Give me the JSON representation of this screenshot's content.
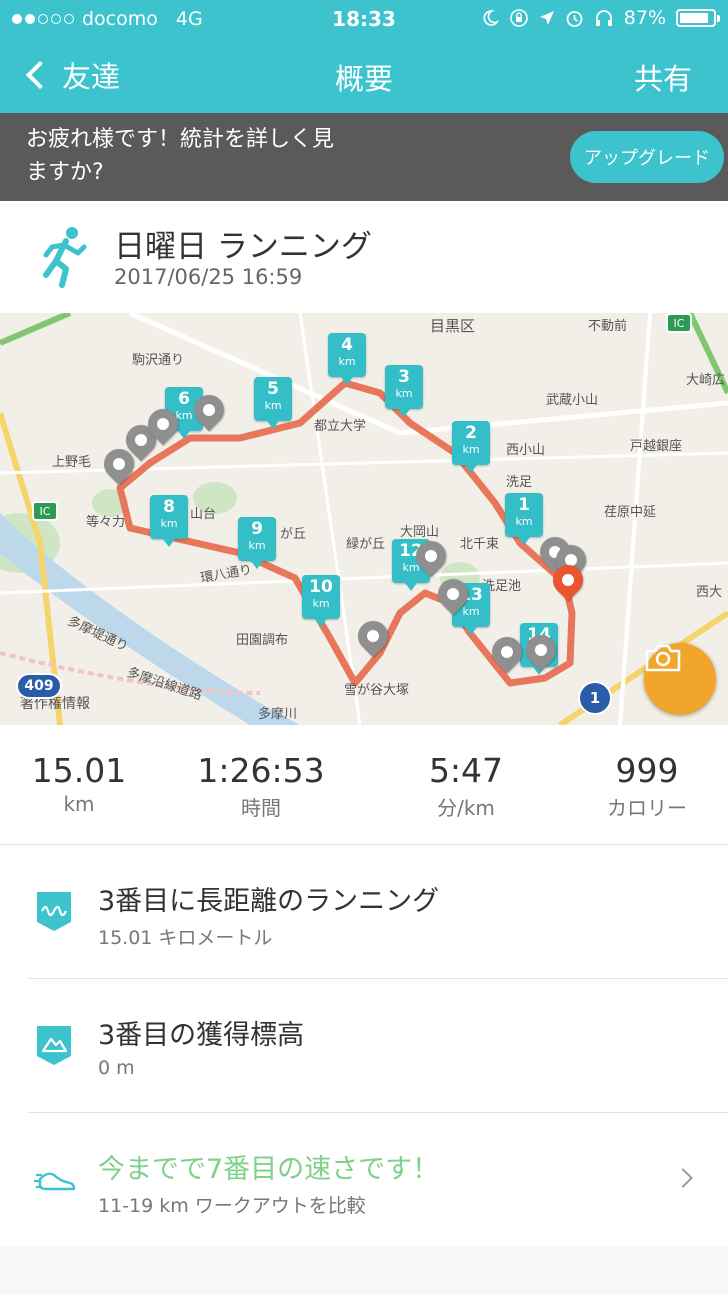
{
  "status_bar": {
    "carrier": "docomo",
    "network": "4G",
    "time": "18:33",
    "battery": "87%",
    "battery_level": 0.87,
    "signal_bars_filled": 2,
    "signal_bars_total": 5
  },
  "nav": {
    "back_label": "友達",
    "title": "概要",
    "share_label": "共有"
  },
  "banner": {
    "message": "お疲れ様です！統計を詳しく見ますか?",
    "button_label": "アップグレード"
  },
  "activity": {
    "name": "日曜日 ランニング",
    "datetime": "2017/06/25 16:59"
  },
  "map": {
    "km_markers": [
      "1",
      "2",
      "3",
      "4",
      "5",
      "6",
      "8",
      "9",
      "10",
      "12",
      "13",
      "14"
    ],
    "km_unit": "km",
    "labels": [
      "駒沢通り",
      "目黒区",
      "不動前",
      "大崎広",
      "武蔵小山",
      "戸越銀座",
      "西小山",
      "洗足",
      "荏原中延",
      "都立大学",
      "上野毛",
      "等々力",
      "山台",
      "が丘",
      "大岡山",
      "北千束",
      "緑が丘",
      "洗足池",
      "田園調布",
      "多摩堤通り",
      "雪が谷大塚",
      "多摩沿線道路",
      "多摩川",
      "西大",
      "環八通り"
    ],
    "attribution": "著作権情報",
    "route_badge": "409",
    "ic_label": "IC",
    "route_1": "1",
    "route_color": "#e8765a",
    "marker_color": "#34bfc8"
  },
  "stats": [
    {
      "value": "15.01",
      "unit": "km"
    },
    {
      "value": "1:26:53",
      "unit": "時間"
    },
    {
      "value": "5:47",
      "unit": "分/km"
    },
    {
      "value": "999",
      "unit": "カロリー"
    }
  ],
  "achievements": [
    {
      "title": "3番目に長距離のランニング",
      "subtitle": "15.01 キロメートル",
      "icon": "distance-badge-icon"
    },
    {
      "title": "3番目の獲得標高",
      "subtitle": "0 m",
      "icon": "elevation-badge-icon"
    },
    {
      "title": "今までで7番目の速さです！",
      "subtitle": "11-19 km ワークアウトを比較",
      "icon": "shoe-speed-icon"
    }
  ],
  "colors": {
    "accent": "#3cc3ce",
    "banner_bg": "#5a5a5a",
    "camera_button": "#f1a52b",
    "green_text": "#7fd089"
  }
}
